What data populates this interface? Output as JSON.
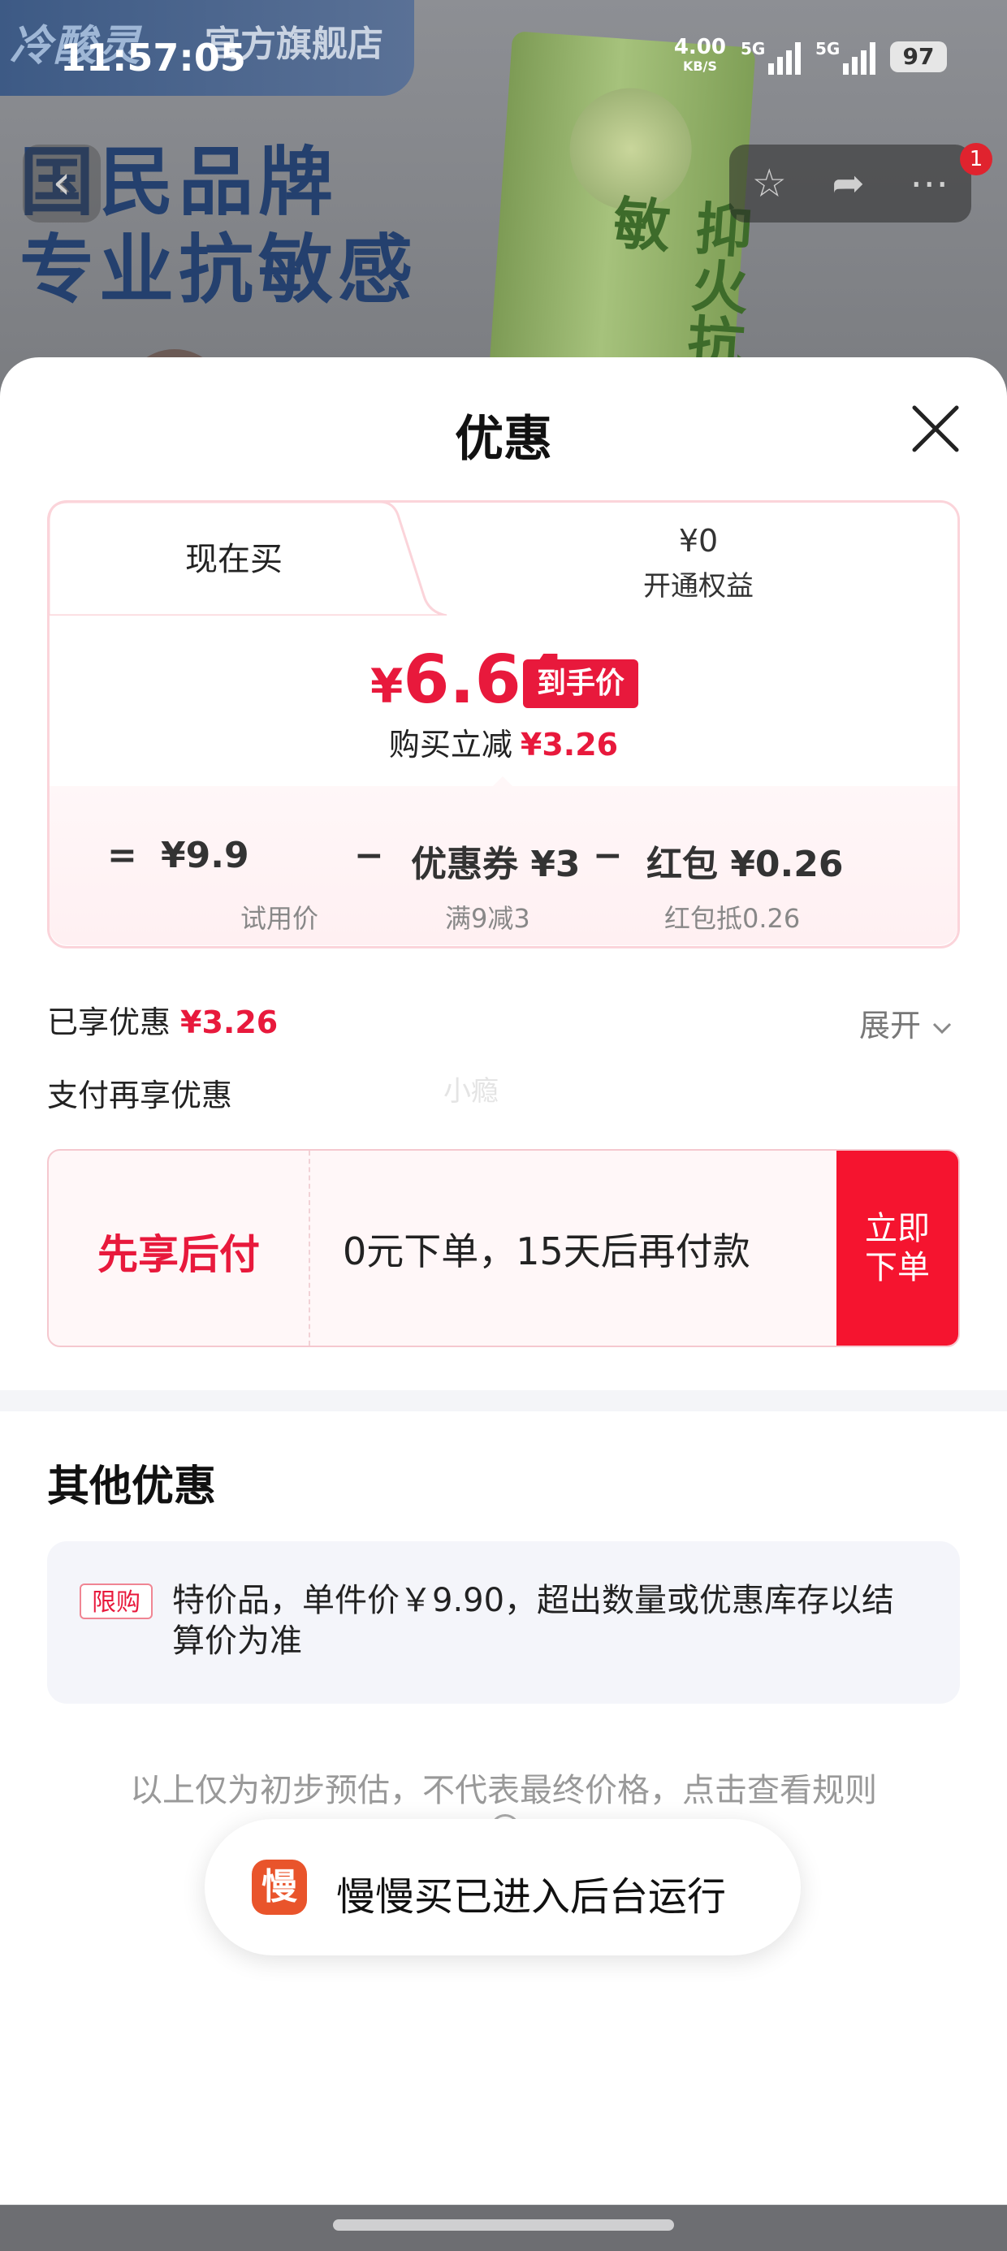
{
  "status_bar": {
    "time": "11:57:05",
    "net_speed": "4.00",
    "net_unit": "KB/S",
    "sim1": "5G",
    "sim2": "5G",
    "battery": "97"
  },
  "background": {
    "shop_logo": "冷酸灵",
    "shop_name": "官方旗舰店",
    "slogan_line1": "国民品牌",
    "slogan_line2": "专业抗敏感",
    "product_text": "抑火抗敏",
    "notification_count": "1",
    "icons": [
      "chevron-left-icon",
      "star-icon",
      "share-icon",
      "more-icon"
    ]
  },
  "sheet": {
    "title": "优惠",
    "tabs": {
      "now": "现在买",
      "vip_price": "¥0",
      "vip_label": "开通权益"
    },
    "final_price_symbol": "¥",
    "final_price_value": "6.64",
    "final_price_tag": "到手价",
    "instant_off_label": "购买立减",
    "instant_off_value": "¥3.26",
    "calc": {
      "equals": "=",
      "minus": "−",
      "trial_value": "¥9.9",
      "trial_label": "试用价",
      "coupon_value": "优惠券 ¥3",
      "coupon_label": "满9减3",
      "redpack_value": "红包 ¥0.26",
      "redpack_label": "红包抵0.26"
    },
    "enjoyed_label": "已享优惠",
    "enjoyed_value": "¥3.26",
    "expand_label": "展开",
    "pay_more_label": "支付再享优惠",
    "watermark": "小瘾",
    "bnpl": {
      "title": "先享后付",
      "desc": "0元下单，15天后再付款",
      "button_line1": "立即",
      "button_line2": "下单"
    },
    "other_title": "其他优惠",
    "limit_tag": "限购",
    "limit_text": "特价品，单件价￥9.90，超出数量或优惠库存以结算价为准",
    "disclaimer": "以上仅为初步预估，不代表最终价格，点击查看规则"
  },
  "toast": {
    "icon_char": "慢",
    "text": "慢慢买已进入后台运行"
  },
  "colors": {
    "accent_red": "#e8193c",
    "button_red": "#f5142f"
  }
}
